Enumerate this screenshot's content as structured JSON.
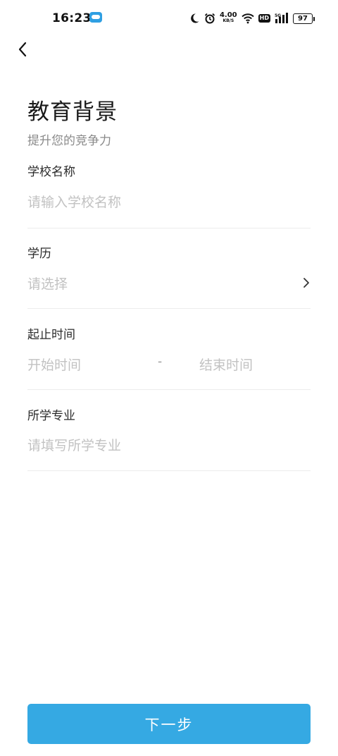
{
  "status_bar": {
    "time": "16:23",
    "net_speed": "4.00",
    "net_unit": "KB/S",
    "hd": "HD",
    "network": "5G",
    "battery": "97"
  },
  "page": {
    "title": "教育背景",
    "subtitle": "提升您的竞争力"
  },
  "form": {
    "school": {
      "label": "学校名称",
      "placeholder": "请输入学校名称"
    },
    "degree": {
      "label": "学历",
      "placeholder": "请选择"
    },
    "period": {
      "label": "起止时间",
      "start_placeholder": "开始时间",
      "separator": "-",
      "end_placeholder": "结束时间"
    },
    "major": {
      "label": "所学专业",
      "placeholder": "请填写所学专业"
    }
  },
  "actions": {
    "next_label": "下一步"
  },
  "icons": {
    "back": "chevron-left-icon",
    "degree_arrow": "chevron-right-icon"
  },
  "colors": {
    "primary": "#35a9e3",
    "divider": "#ececec",
    "placeholder": "#c2c2c2"
  }
}
